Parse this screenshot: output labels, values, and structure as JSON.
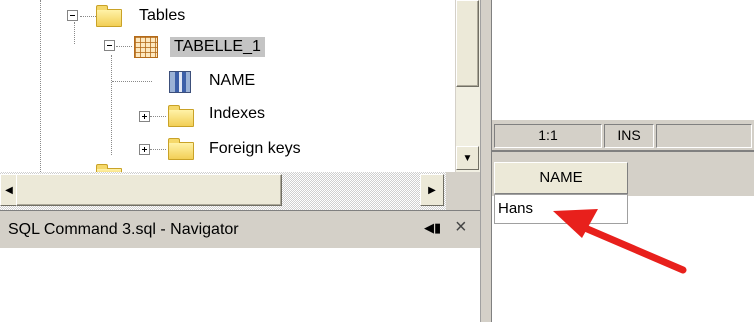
{
  "tree": {
    "items": [
      {
        "label": "Tables",
        "icon": "folder-icon",
        "expander": "minus"
      },
      {
        "label": "TABELLE_1",
        "icon": "table-icon",
        "expander": "minus",
        "selected": true
      },
      {
        "label": "NAME",
        "icon": "column-icon"
      },
      {
        "label": "Indexes",
        "icon": "folder-icon",
        "expander": "plus"
      },
      {
        "label": "Foreign keys",
        "icon": "folder-icon",
        "expander": "plus"
      }
    ]
  },
  "navigator": {
    "title": "SQL Command 3.sql - Navigator",
    "pin_glyph": "◀▮",
    "close_glyph": "×"
  },
  "status_bar": {
    "position": "1:1",
    "mode": "INS"
  },
  "result_grid": {
    "columns": [
      "NAME"
    ],
    "rows": [
      [
        "Hans"
      ]
    ]
  },
  "colors": {
    "panel_gray": "#d4d0c8",
    "selection_gray": "#c4c4c4",
    "annotation_arrow": "#e8201c"
  }
}
